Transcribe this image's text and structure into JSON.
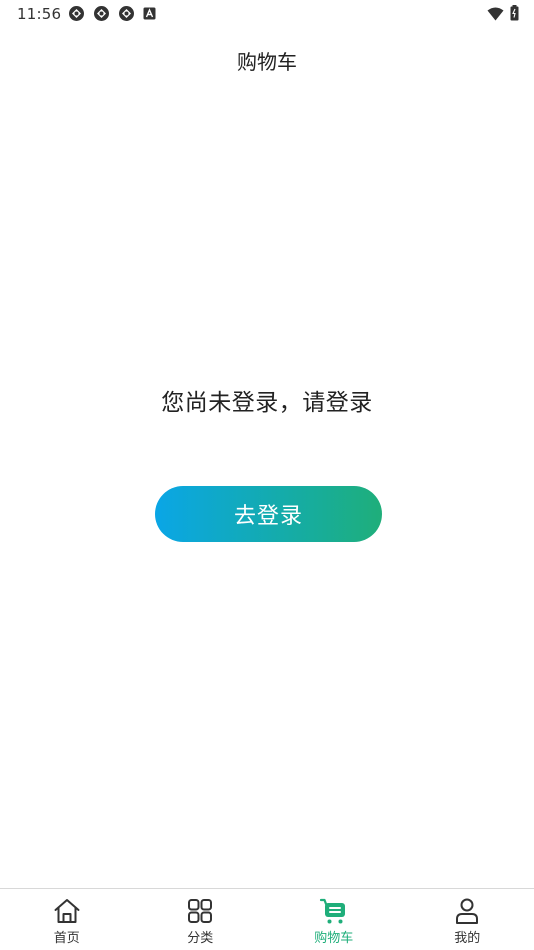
{
  "status_bar": {
    "time": "11:56",
    "left_icons": [
      "sync-icon",
      "sync-icon",
      "sync-icon",
      "notification-a-icon"
    ],
    "right_icons": [
      "wifi-icon",
      "battery-icon"
    ]
  },
  "header": {
    "title": "购物车"
  },
  "main": {
    "message": "您尚未登录，请登录",
    "login_button_label": "去登录"
  },
  "bottom_nav": {
    "items": [
      {
        "label": "首页",
        "icon": "home-icon",
        "active": false
      },
      {
        "label": "分类",
        "icon": "category-grid-icon",
        "active": false
      },
      {
        "label": "购物车",
        "icon": "cart-icon",
        "active": true
      },
      {
        "label": "我的",
        "icon": "user-icon",
        "active": false
      }
    ]
  },
  "colors": {
    "accent": "#1fae7a",
    "button_gradient_start": "#0aa6e6",
    "button_gradient_end": "#1fae7a",
    "inactive_icon": "#333333"
  }
}
